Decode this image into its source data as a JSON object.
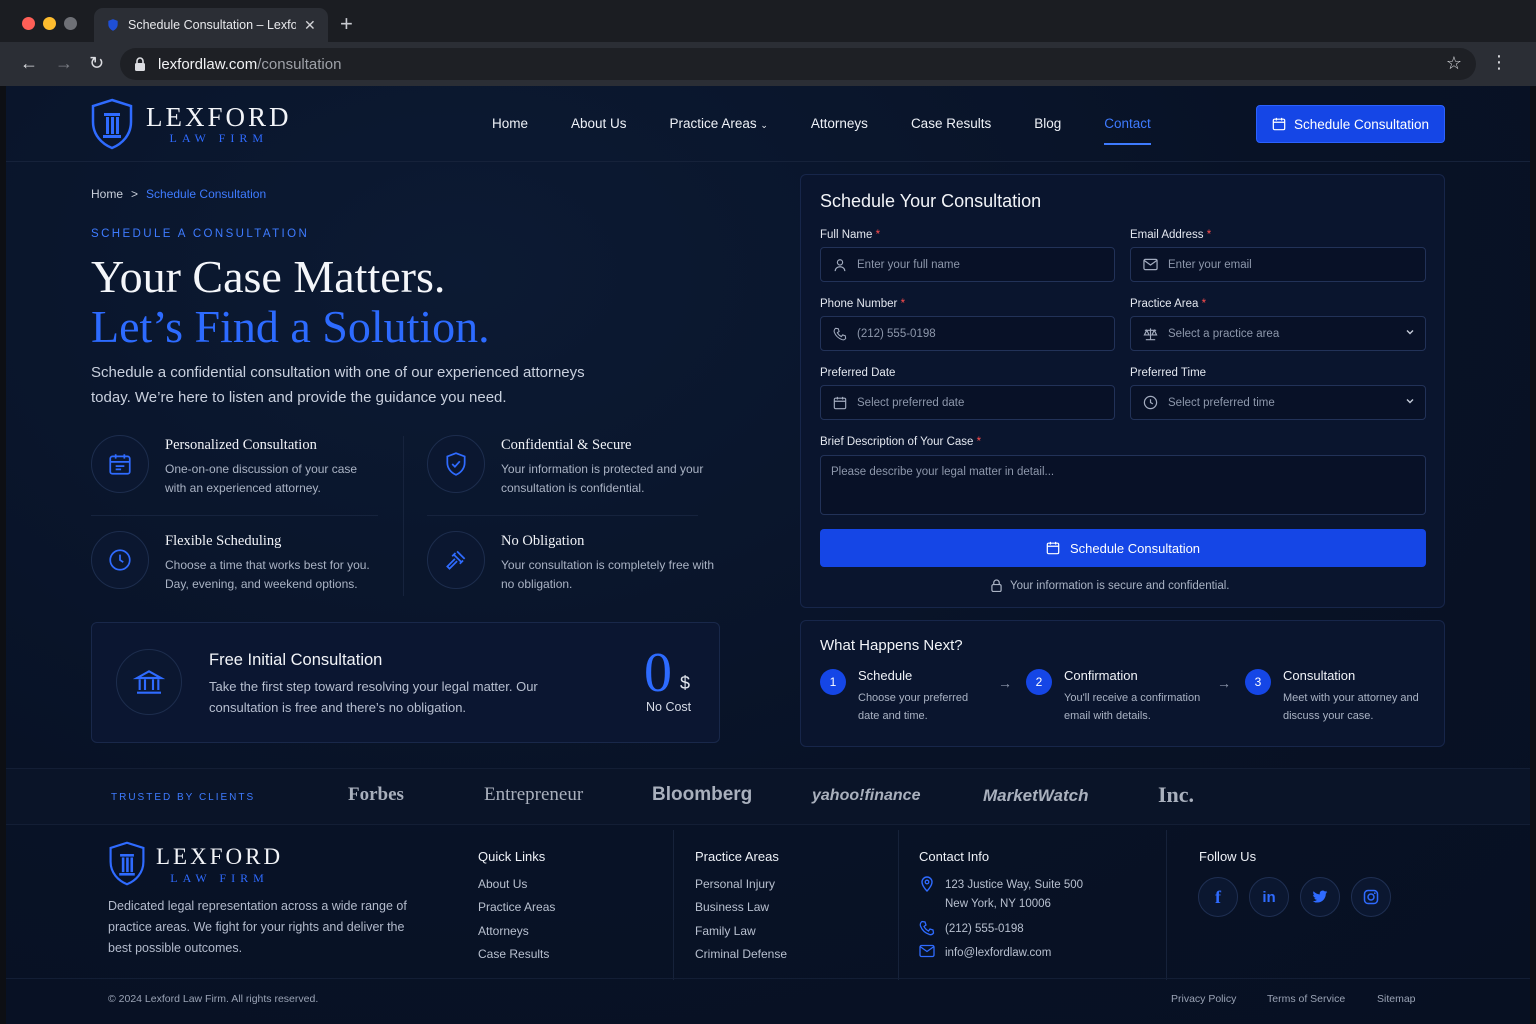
{
  "browser": {
    "tab_title": "Schedule Consultation – Lexford Law Firm",
    "url_domain": "lexfordlaw.com",
    "url_path": "/consultation"
  },
  "brand": {
    "name": "LEXFORD",
    "tagline": "LAW FIRM"
  },
  "nav": {
    "items": [
      "Home",
      "About Us",
      "Practice Areas",
      "Attorneys",
      "Case Results",
      "Blog",
      "Contact"
    ],
    "cta": "Schedule Consultation"
  },
  "breadcrumb": {
    "home": "Home",
    "sep": ">",
    "current": "Schedule Consultation"
  },
  "hero": {
    "eyebrow": "SCHEDULE A CONSULTATION",
    "line1": "Your Case Matters.",
    "line2": "Let’s Find a Solution.",
    "paragraph": "Schedule a confidential consultation with one of our experienced attorneys today. We’re here to listen and provide the guidance you need."
  },
  "features": [
    {
      "title": "Personalized Consultation",
      "desc": "One-on-one discussion of your case with an experienced attorney.",
      "icon": "calendar-icon"
    },
    {
      "title": "Confidential & Secure",
      "desc": "Your information is protected and your consultation is confidential.",
      "icon": "shield-check-icon"
    },
    {
      "title": "Flexible Scheduling",
      "desc": "Choose a time that works best for you. Day, evening, and weekend options.",
      "icon": "clock-icon"
    },
    {
      "title": "No Obligation",
      "desc": "Your consultation is completely free with no obligation.",
      "icon": "gavel-icon"
    }
  ],
  "free": {
    "title": "Free Initial Consultation",
    "desc": "Take the first step toward resolving your legal matter. Our consultation is free and there’s no obligation.",
    "amount": "0",
    "currency": "$",
    "label": "No Cost"
  },
  "form": {
    "title": "Schedule Your Consultation",
    "full_name": {
      "label": "Full Name",
      "placeholder": "Enter your full name"
    },
    "email": {
      "label": "Email Address",
      "placeholder": "Enter your email"
    },
    "phone": {
      "label": "Phone Number",
      "placeholder": "(212) 555-0198"
    },
    "practice": {
      "label": "Practice Area",
      "placeholder": "Select a practice area"
    },
    "date": {
      "label": "Preferred Date",
      "placeholder": "Select preferred date"
    },
    "time": {
      "label": "Preferred Time",
      "placeholder": "Select preferred time"
    },
    "description": {
      "label": "Brief Description of Your Case",
      "placeholder": "Please describe your legal matter in detail..."
    },
    "required_mark": "*",
    "submit": "Schedule Consultation",
    "secure_note": "Your information is secure and confidential."
  },
  "next": {
    "title": "What Happens Next?",
    "steps": [
      {
        "num": "1",
        "title": "Schedule",
        "desc": "Choose your preferred date and time."
      },
      {
        "num": "2",
        "title": "Confirmation",
        "desc": "You'll receive a confirmation email with details."
      },
      {
        "num": "3",
        "title": "Consultation",
        "desc": "Meet with your attorney and discuss your case."
      }
    ]
  },
  "trusted": {
    "label": "TRUSTED BY CLIENTS",
    "brands": [
      "Forbes",
      "Entrepreneur",
      "Bloomberg",
      "yahoo!finance",
      "MarketWatch",
      "Inc."
    ]
  },
  "footer": {
    "about": "Dedicated legal representation across a wide range of practice areas. We fight for your rights and deliver the best possible outcomes.",
    "quick_links": {
      "title": "Quick Links",
      "items": [
        "About Us",
        "Practice Areas",
        "Attorneys",
        "Case Results"
      ]
    },
    "practice_areas": {
      "title": "Practice Areas",
      "items": [
        "Personal Injury",
        "Business Law",
        "Family Law",
        "Criminal Defense"
      ]
    },
    "contact": {
      "title": "Contact Info",
      "address1": "123 Justice Way, Suite 500",
      "address2": "New York, NY 10006",
      "phone": "(212) 555-0198",
      "email": "info@lexfordlaw.com"
    },
    "follow": {
      "title": "Follow Us",
      "networks": [
        "f",
        "in",
        "t",
        "ig"
      ]
    },
    "copyright": "© 2024 Lexford Law Firm. All rights reserved.",
    "legal_links": [
      "Privacy Policy",
      "Terms of Service",
      "Sitemap"
    ]
  },
  "colors": {
    "accent": "#1546e6",
    "link": "#3e7bff",
    "background": "#081226",
    "required": "#ff4d4d"
  }
}
